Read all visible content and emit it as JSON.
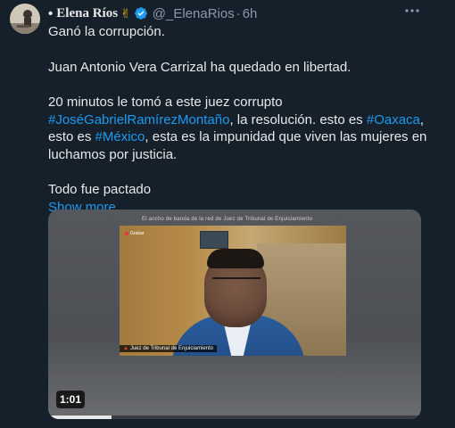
{
  "author": {
    "name": "Elena Ríos",
    "bullet": "•",
    "emoji": "✌",
    "handle": "@_ElenaRios",
    "separator": "·",
    "time": "6h"
  },
  "tweet": {
    "line1": "Ganó la corrupción.",
    "line2": "Juan Antonio Vera Carrizal ha quedado en libertad.",
    "line3": "20 minutos le tomó a este juez corrupto",
    "hashtag_judge": "#JoséGabrielRamírezMontaño",
    "line4_rest": ", la resolución. esto es ",
    "hashtag_oaxaca": "#Oaxaca",
    "line4_end": ",",
    "line5_start": "esto es ",
    "hashtag_mexico": "#México",
    "line5_rest": ", esta es la impunidad que viven las mujeres en",
    "line6": "luchamos por justicia.",
    "line7": "Todo fue pactado",
    "show_more": "Show more"
  },
  "media": {
    "duration": "1:01",
    "progress": 0.17,
    "zoom_title": "El ancho de banda de la red de Juez de Tribunal de Enjuiciamiento",
    "zoom_top_label": "Grabar",
    "zoom_name": "Juez de Tribunal de Enjuiciamiento"
  },
  "icons": {
    "more": "more-horizontal-icon",
    "verified": "verified-badge-icon"
  },
  "colors": {
    "accent": "#1d9bf0",
    "background": "#15202b",
    "muted": "#8b98a5"
  }
}
